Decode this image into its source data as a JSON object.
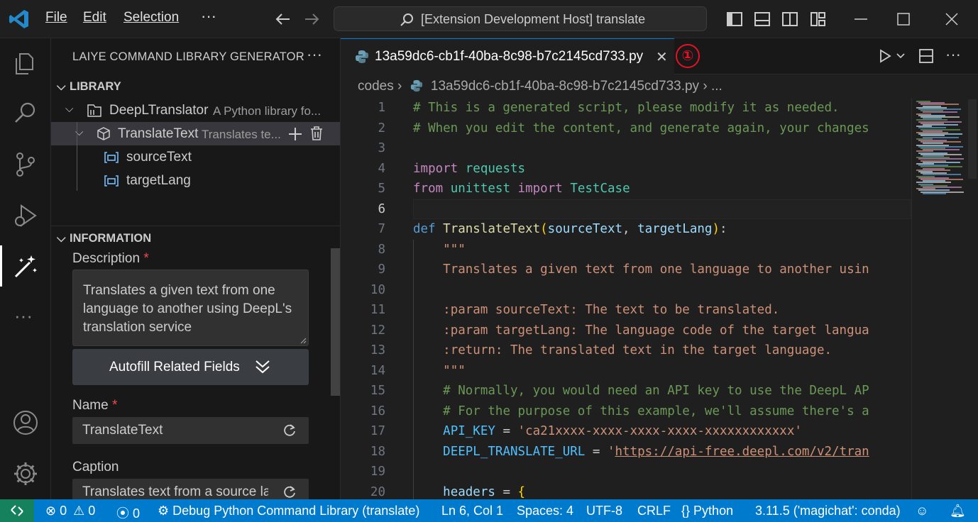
{
  "titlebar": {
    "menu": [
      "File",
      "Edit",
      "Selection"
    ],
    "more": "···",
    "command_center": "[Extension Development Host] translate"
  },
  "sidebar": {
    "title": "LAIYE COMMAND LIBRARY GENERATOR",
    "more": "···",
    "library_header": "LIBRARY",
    "library_items": [
      {
        "name": "DeepLTranslator",
        "desc": "A Python library fo..."
      },
      {
        "name": "TranslateText",
        "desc": "Translates te..."
      },
      {
        "name": "sourceText"
      },
      {
        "name": "targetLang"
      }
    ],
    "info_header": "INFORMATION",
    "description_label": "Description",
    "required_mark": "*",
    "description_value": "Translates a given text from one language to another using DeepL's translation service",
    "autofill_label": "Autofill Related Fields",
    "name_label": "Name",
    "name_value": "TranslateText",
    "caption_label": "Caption",
    "caption_value": "Translates text from a source la"
  },
  "editor": {
    "tab_name": "13a59dc6-cb1f-40ba-8c98-b7c2145cd733.py",
    "tab_close": "✕",
    "annotation_badge": "①",
    "breadcrumb_folder": "codes",
    "breadcrumb_file": "13a59dc6-cb1f-40ba-8c98-b7c2145cd733.py",
    "breadcrumb_tail": "...",
    "current_line": 6
  },
  "code_lines": [
    {
      "n": "1",
      "text": "# This is a generated script, please modify it as needed."
    },
    {
      "n": "2",
      "text": "# When you edit the content, and generate again, your changes"
    },
    {
      "n": "3",
      "text": ""
    },
    {
      "n": "4",
      "text": "import requests"
    },
    {
      "n": "5",
      "text": "from unittest import TestCase"
    },
    {
      "n": "6",
      "text": ""
    },
    {
      "n": "7",
      "text": "def TranslateText(sourceText, targetLang):"
    },
    {
      "n": "8",
      "text": "    \"\"\""
    },
    {
      "n": "9",
      "text": "    Translates a given text from one language to another usin"
    },
    {
      "n": "10",
      "text": ""
    },
    {
      "n": "11",
      "text": "    :param sourceText: The text to be translated."
    },
    {
      "n": "12",
      "text": "    :param targetLang: The language code of the target langua"
    },
    {
      "n": "13",
      "text": "    :return: The translated text in the target language."
    },
    {
      "n": "14",
      "text": "    \"\"\""
    },
    {
      "n": "15",
      "text": "    # Normally, you would need an API key to use the DeepL AP"
    },
    {
      "n": "16",
      "text": "    # For the purpose of this example, we'll assume there's a"
    },
    {
      "n": "17",
      "text": "    API_KEY = 'ca21xxxx-xxxx-xxxx-xxxx-xxxxxxxxxxxx'"
    },
    {
      "n": "18",
      "text": "    DEEPL_TRANSLATE_URL = 'https://api-free.deepl.com/v2/tran"
    },
    {
      "n": "19",
      "text": ""
    },
    {
      "n": "20",
      "text": "    headers = {"
    }
  ],
  "statusbar": {
    "errors": "0",
    "warnings": "0",
    "ports": "0",
    "debug": "Debug Python Command Library (translate)",
    "position": "Ln 6, Col 1",
    "spaces": "Spaces: 4",
    "encoding": "UTF-8",
    "eol": "CRLF",
    "language": "Python",
    "interpreter": "3.11.5 ('magichat': conda)"
  },
  "colors": {
    "accent": "#007acc",
    "remote": "#16825d",
    "badge": "#e81123",
    "comment": "#6a9955",
    "string": "#ce9178",
    "keyword": "#c586c0"
  }
}
